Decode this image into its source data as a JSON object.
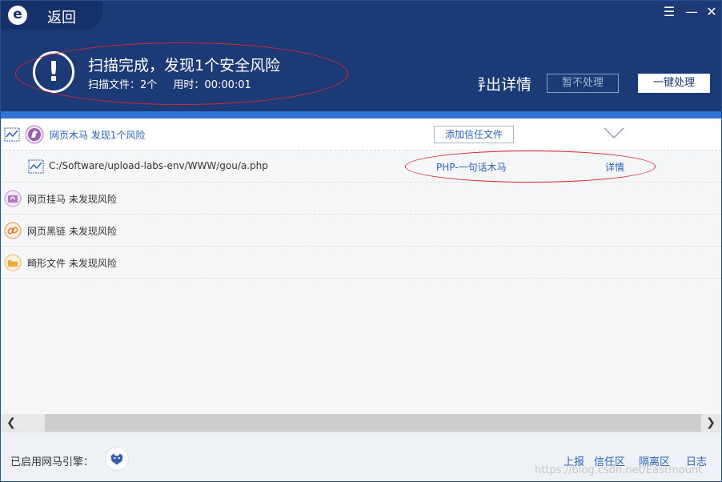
{
  "header": {
    "back_label": "返回",
    "title": "扫描完成，发现1个安全风险",
    "scanned_files": "扫描文件：2个",
    "elapsed": "用时：00:00:01",
    "export_label": "导出详情",
    "ignore_button": "暂不处理",
    "one_click_button": "一键处理"
  },
  "categories": [
    {
      "label": "网页木马 发现1个风险",
      "trust_button": "添加信任文件",
      "highlight": true
    },
    {
      "label": "网页挂马 未发现风险"
    },
    {
      "label": "网页黑链 未发现风险"
    },
    {
      "label": "畸形文件 未发现风险"
    }
  ],
  "files": [
    {
      "path": "C:/Software/upload-labs-env/WWW/gou/a.php",
      "threat": "PHP-一句话木马",
      "detail_link": "详情"
    }
  ],
  "footer": {
    "engine_label": "已启用网马引擎：",
    "links": [
      "上报",
      "信任区",
      "隔离区",
      "日志"
    ],
    "watermark": "https://blog.csdn.net/Eastmount"
  },
  "colors": {
    "header_bg": "#1c3a75",
    "accent_blue": "#2f73d6",
    "link_blue": "#2c63b4",
    "annotation_red": "#d8272f"
  }
}
